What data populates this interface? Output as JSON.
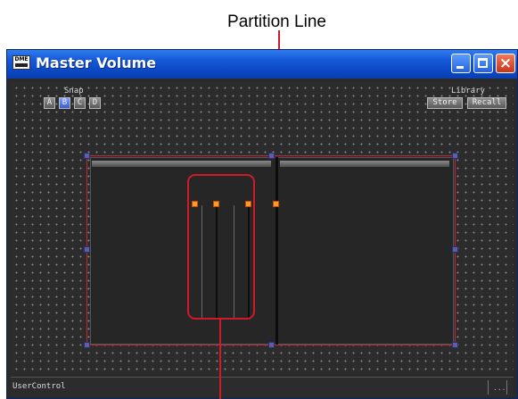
{
  "annotation": {
    "top_label": "Partition Line"
  },
  "window": {
    "title": "Master Volume",
    "icon_text": "DME",
    "buttons": {
      "minimize": "minimize",
      "maximize": "maximize",
      "close": "×"
    }
  },
  "snap": {
    "label": "Snap",
    "options": [
      "A",
      "B",
      "C",
      "D"
    ],
    "selected": "B"
  },
  "library": {
    "label": "Library",
    "store": "Store",
    "recall": "Recall"
  },
  "status": {
    "text": "UserControl",
    "right_glyph": "..."
  },
  "colors": {
    "titlebar": "#0b49c4",
    "highlight": "#d01a2a",
    "handle": "#5a5fa6",
    "handle_selected": "#ff9a2a"
  }
}
